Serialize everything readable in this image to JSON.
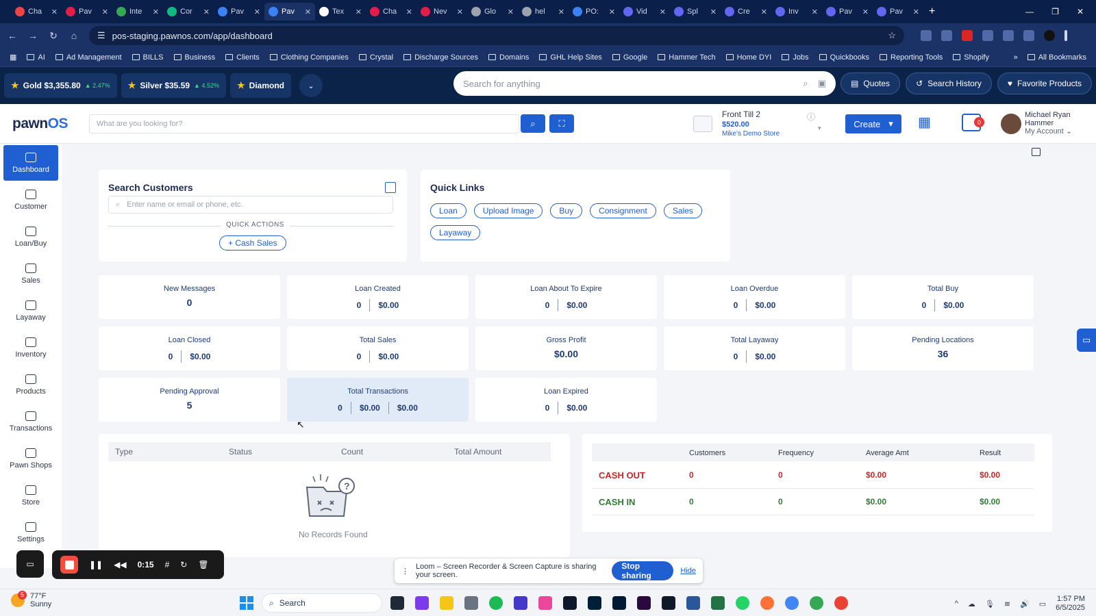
{
  "browser": {
    "tabs": [
      {
        "title": "Cha",
        "color": "#ef4444"
      },
      {
        "title": "Pav",
        "color": "#e11d48"
      },
      {
        "title": "Inte",
        "color": "#34a853"
      },
      {
        "title": "Cor",
        "color": "#10b981"
      },
      {
        "title": "Pav",
        "color": "#3b82f6"
      },
      {
        "title": "Pav",
        "color": "#3b82f6",
        "active": true
      },
      {
        "title": "Tex",
        "color": "#ffffff"
      },
      {
        "title": "Cha",
        "color": "#e11d48"
      },
      {
        "title": "Nev",
        "color": "#e11d48"
      },
      {
        "title": "Glo",
        "color": "#9ca3af"
      },
      {
        "title": "hel",
        "color": "#9ca3af"
      },
      {
        "title": "PO:",
        "color": "#3b82f6"
      },
      {
        "title": "Vid",
        "color": "#6366f1"
      },
      {
        "title": "Spl",
        "color": "#6366f1"
      },
      {
        "title": "Cre",
        "color": "#6366f1"
      },
      {
        "title": "Inv",
        "color": "#6366f1"
      },
      {
        "title": "Pav",
        "color": "#6366f1"
      },
      {
        "title": "Pav",
        "color": "#6366f1"
      }
    ],
    "url": "pos-staging.pawnos.com/app/dashboard",
    "bookmarks": [
      "AI",
      "Ad Management",
      "BILLS",
      "Business",
      "Clients",
      "Clothing Companies",
      "Crystal",
      "Discharge Sources",
      "Domains",
      "GHL Help Sites",
      "Google",
      "Hammer Tech",
      "Home DYI",
      "Jobs",
      "Quickbooks",
      "Reporting Tools",
      "Shopify"
    ],
    "all_bookmarks": "All Bookmarks"
  },
  "metals": {
    "gold": {
      "label": "Gold $3,355.80",
      "change": "2.47%"
    },
    "silver": {
      "label": "Silver $35.59",
      "change": "4.52%"
    },
    "diamond": {
      "label": "Diamond"
    }
  },
  "topbar": {
    "search_placeholder": "Search for anything",
    "quotes": "Quotes",
    "search_history": "Search History",
    "favorite_products": "Favorite Products"
  },
  "header": {
    "logo_main": "pawn",
    "logo_accent": "OS",
    "search_placeholder": "What are you looking for?",
    "till_name": "Front Till 2",
    "till_amount": "$520.00",
    "till_store": "Mike's Demo Store",
    "create": "Create",
    "notif_count": "0",
    "user_name_1": "Michael Ryan",
    "user_name_2": "Hammer",
    "my_account": "My Account"
  },
  "sidebar": [
    {
      "label": "Dashboard",
      "name": "dashboard"
    },
    {
      "label": "Customer",
      "name": "customer"
    },
    {
      "label": "Loan/Buy",
      "name": "loan-buy"
    },
    {
      "label": "Sales",
      "name": "sales"
    },
    {
      "label": "Layaway",
      "name": "layaway"
    },
    {
      "label": "Inventory",
      "name": "inventory"
    },
    {
      "label": "Products",
      "name": "products"
    },
    {
      "label": "Transactions",
      "name": "transactions"
    },
    {
      "label": "Pawn Shops",
      "name": "pawn-shops"
    },
    {
      "label": "Store",
      "name": "store"
    },
    {
      "label": "Settings",
      "name": "settings"
    }
  ],
  "search_customers": {
    "title": "Search Customers",
    "placeholder": "Enter name or email or phone, etc.",
    "quick_actions": "QUICK ACTIONS",
    "cash_sales": "+ Cash Sales"
  },
  "quick_links": {
    "title": "Quick Links",
    "links": [
      "Loan",
      "Upload Image",
      "Buy",
      "Consignment",
      "Sales",
      "Layaway"
    ]
  },
  "stats": [
    {
      "label": "New Messages",
      "big": "0"
    },
    {
      "label": "Loan Created",
      "values": [
        "0",
        "$0.00"
      ]
    },
    {
      "label": "Loan About To Expire",
      "values": [
        "0",
        "$0.00"
      ]
    },
    {
      "label": "Loan Overdue",
      "values": [
        "0",
        "$0.00"
      ]
    },
    {
      "label": "Total Buy",
      "values": [
        "0",
        "$0.00"
      ]
    },
    {
      "label": "Loan Closed",
      "values": [
        "0",
        "$0.00"
      ]
    },
    {
      "label": "Total Sales",
      "values": [
        "0",
        "$0.00"
      ]
    },
    {
      "label": "Gross Profit",
      "big": "$0.00"
    },
    {
      "label": "Total Layaway",
      "values": [
        "0",
        "$0.00"
      ]
    },
    {
      "label": "Pending Locations",
      "big": "36"
    },
    {
      "label": "Pending Approval",
      "big": "5"
    },
    {
      "label": "Total Transactions",
      "values": [
        "0",
        "$0.00",
        "$0.00"
      ],
      "highlight": true
    },
    {
      "label": "Loan Expired",
      "values": [
        "0",
        "$0.00"
      ]
    }
  ],
  "transactions_table": {
    "columns": [
      "Type",
      "Status",
      "Count",
      "Total Amount"
    ],
    "empty_text": "No Records Found"
  },
  "cash_flow": {
    "columns": [
      "Customers",
      "Frequency",
      "Average Amt",
      "Result"
    ],
    "rows": [
      {
        "label": "CASH OUT",
        "values": [
          "0",
          "0",
          "$0.00",
          "$0.00"
        ],
        "color": "#c62828"
      },
      {
        "label": "CASH IN",
        "values": [
          "0",
          "0",
          "$0.00",
          "$0.00"
        ],
        "color": "#2e7d32"
      }
    ]
  },
  "loom": {
    "time": "0:15",
    "share_text": "Loom – Screen Recorder & Screen Capture is sharing your screen.",
    "stop_sharing": "Stop sharing",
    "hide": "Hide"
  },
  "taskbar": {
    "weather_badge": "5",
    "temp": "77°F",
    "condition": "Sunny",
    "search": "Search",
    "time": "1:57 PM",
    "date": "6/5/2025"
  }
}
